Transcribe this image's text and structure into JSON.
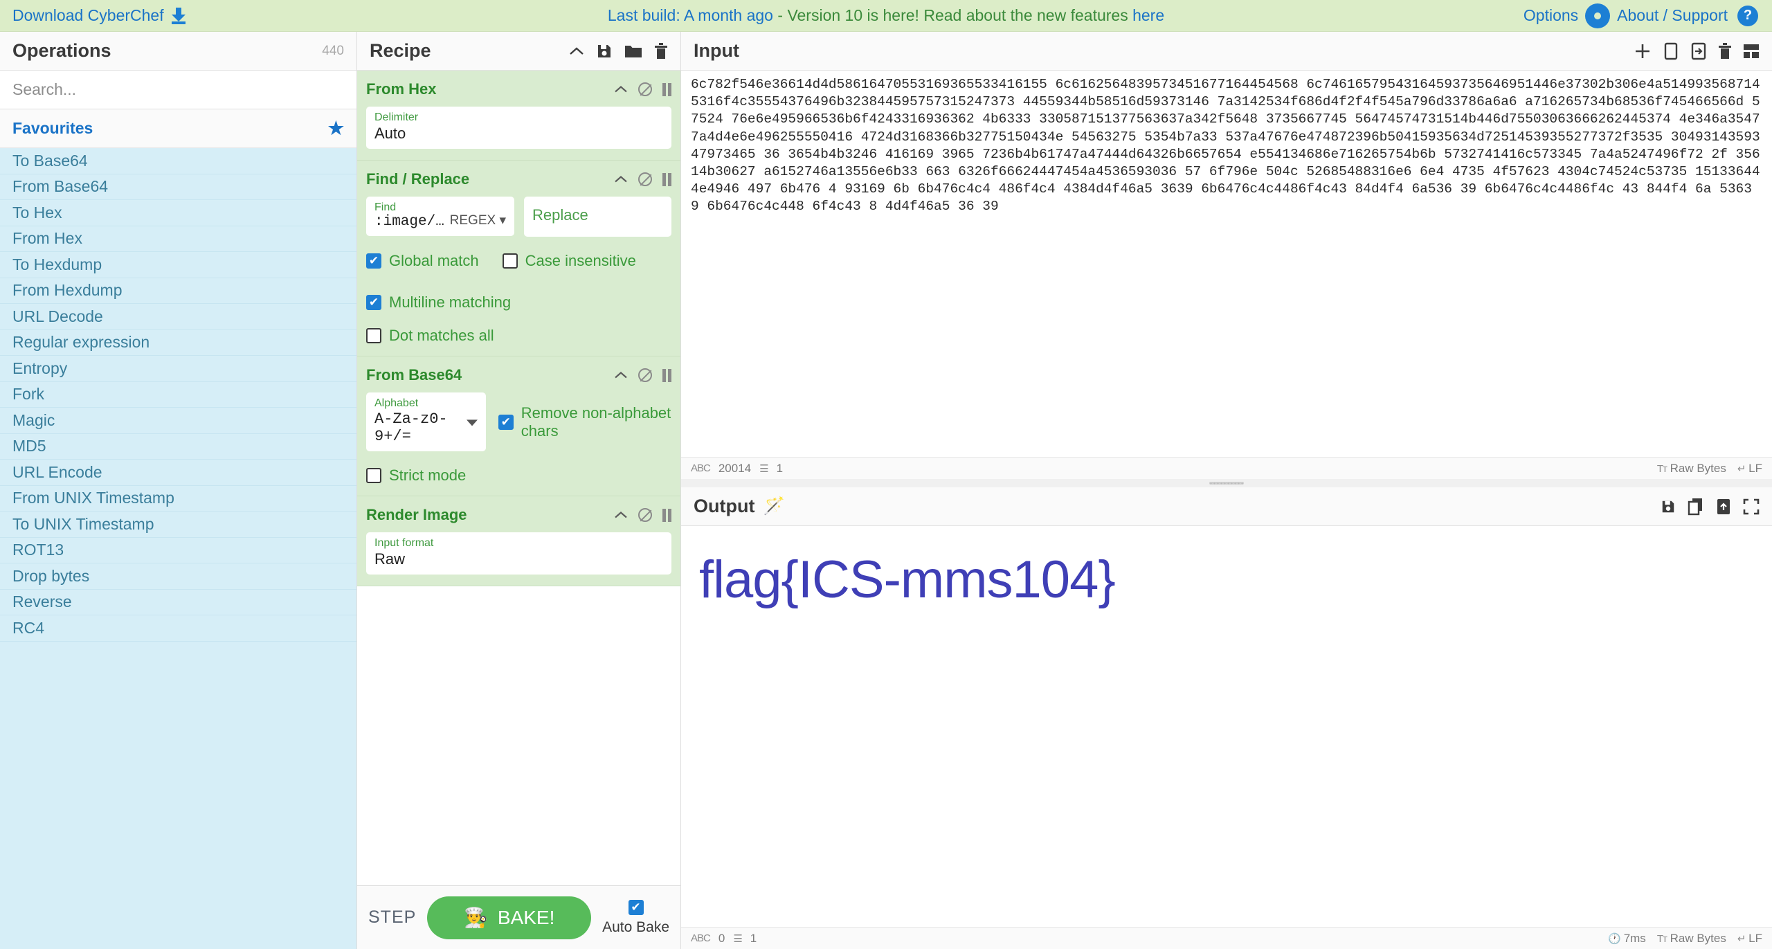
{
  "banner": {
    "download_label": "Download CyberChef",
    "download_icon": "download-icon",
    "last_build": "Last build: A month ago",
    "separator": " - ",
    "version_text": "Version 10 is here! Read about the new features ",
    "here_link": "here",
    "options_label": "Options",
    "options_icon": "gear-icon",
    "about_label": "About / Support",
    "about_icon": "question-circle-icon"
  },
  "operations": {
    "title": "Operations",
    "count": "440",
    "search_placeholder": "Search...",
    "favourites_label": "Favourites",
    "star_icon": "star-icon",
    "items": [
      {
        "label": "To Base64"
      },
      {
        "label": "From Base64"
      },
      {
        "label": "To Hex"
      },
      {
        "label": "From Hex"
      },
      {
        "label": "To Hexdump"
      },
      {
        "label": "From Hexdump"
      },
      {
        "label": "URL Decode"
      },
      {
        "label": "Regular expression"
      },
      {
        "label": "Entropy"
      },
      {
        "label": "Fork"
      },
      {
        "label": "Magic"
      },
      {
        "label": "MD5"
      },
      {
        "label": "URL Encode"
      },
      {
        "label": "From UNIX Timestamp"
      },
      {
        "label": "To UNIX Timestamp"
      },
      {
        "label": "ROT13"
      },
      {
        "label": "Drop bytes"
      },
      {
        "label": "Reverse"
      },
      {
        "label": "RC4"
      }
    ]
  },
  "recipe": {
    "title": "Recipe",
    "header_icons": [
      "chevron-up-icon",
      "save-icon",
      "folder-icon",
      "trash-icon"
    ],
    "op_controls": [
      "chevron-up-icon",
      "disable-icon",
      "pause-icon"
    ],
    "operations": [
      {
        "name": "From Hex",
        "args": [
          {
            "label": "Delimiter",
            "value": "Auto",
            "type": "text"
          }
        ]
      },
      {
        "name": "Find / Replace",
        "find_label": "Find",
        "find_value": ":image/png;ba…",
        "regex_label": "REGEX",
        "replace_placeholder": "Replace",
        "checkboxes": [
          {
            "label": "Global match",
            "checked": true
          },
          {
            "label": "Case insensitive",
            "checked": false
          },
          {
            "label": "Multiline matching",
            "checked": true
          },
          {
            "label": "Dot matches all",
            "checked": false
          }
        ]
      },
      {
        "name": "From Base64",
        "alphabet_label": "Alphabet",
        "alphabet_value": "A-Za-z0-9+/=",
        "checkboxes": [
          {
            "label": "Remove non-alphabet chars",
            "checked": true
          },
          {
            "label": "Strict mode",
            "checked": false
          }
        ]
      },
      {
        "name": "Render Image",
        "args": [
          {
            "label": "Input format",
            "value": "Raw",
            "type": "text"
          }
        ]
      }
    ],
    "step_label": "STEP",
    "bake_label": "BAKE!",
    "bake_icon": "chef-icon",
    "auto_bake_label": "Auto Bake",
    "auto_bake_checked": true
  },
  "input": {
    "title": "Input",
    "header_icons": [
      "plus-icon",
      "folder-open-icon",
      "open-in-icon",
      "trash-icon",
      "layout-icon"
    ],
    "content": "6c782f546e36614d4d58616470553169365533416155 6c6162564839573451677164454568 6c74616579543164593735646951446e37302b306e4a5149935687145316f4c35554376496b323844595757315247373 44559344b58516d59373146 7a3142534f686d4f2f4f545a796d33786a6a6 a716265734b68536f745466566d 57524 76e6e495966536b6f4243316936362 4b6333 330587151377563637a342f5648 3735667745 56474574731514b446d75503063666262445374 4e346a35477a4d4e6e496255550416 4724d3168366b32775150434e 54563275 5354b7a33 537a47676e474872396b50415935634d72514539355277372f3535 3049314359347973465 36 3654b4b3246 416169 3965 7236b4b61747a47444d64326b6657654 e554134686e716265754b6b 5732741416c573345 7a4a5247496f72 2f 356 14b30627 a6152746a13556e6b33 663 6326f66624447454a4536593036 57 6f796e 504c 52685488316e6 6e4 4735 4f57623 4304c74524c53735 15133644 4e4946 497 6b476 4 93169 6b 6b476c4c4 486f4c4 4384d4f46a5 3639 6b6476c4c4486f4c43 84d4f4 6a536 39 6b6476c4c4486f4c 43 844f4 6a 5363 9 6b6476c4c448 6f4c43 8 4d4f46a5 36 39",
    "status": {
      "chars_icon": "abc-icon",
      "chars": "20014",
      "lines_icon": "lines-icon",
      "lines": "1",
      "format_icon": "font-icon",
      "format": "Raw Bytes",
      "eol_icon": "return-icon",
      "eol": "LF"
    }
  },
  "output": {
    "title": "Output",
    "magic_icon": "magic-wand-icon",
    "header_icons": [
      "save-icon",
      "copy-icon",
      "export-to-input-icon",
      "maximize-icon"
    ],
    "rendered_text": "flag{ICS-mms104}",
    "rendered_text_color": "#3f3fb6",
    "status": {
      "chars_icon": "abc-icon",
      "chars": "0",
      "lines_icon": "lines-icon",
      "lines": "1",
      "timer_icon": "clock-icon",
      "duration": "7ms",
      "format_icon": "font-icon",
      "format": "Raw Bytes",
      "eol_icon": "return-icon",
      "eol": "LF"
    }
  },
  "colors": {
    "banner_bg": "#dcedc8",
    "link": "#1a73c7",
    "op_list_bg": "#d6eef7",
    "recipe_op_bg": "#d9ecd0",
    "bake_green": "#57bb5a",
    "checkbox_blue": "#1d7fd4"
  }
}
